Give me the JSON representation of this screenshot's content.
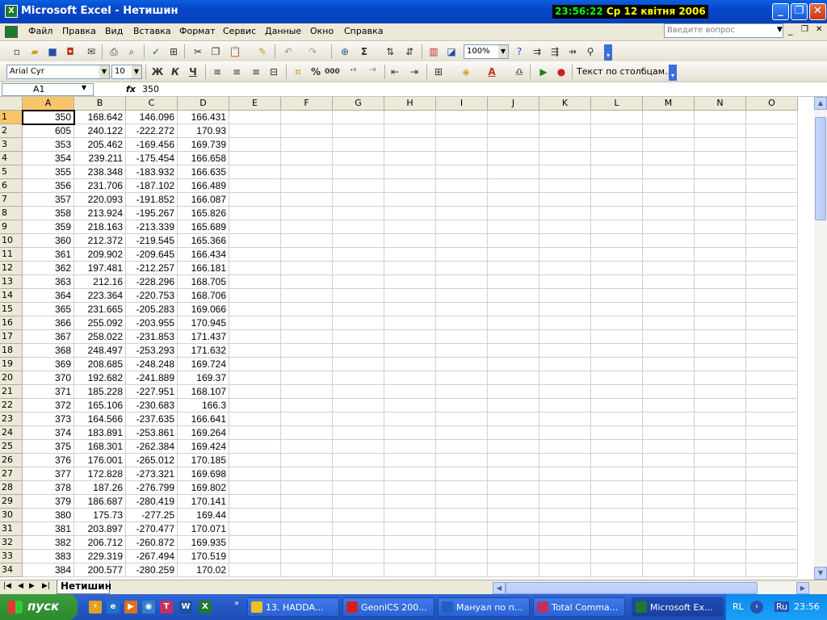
{
  "window": {
    "title": "Microsoft Excel - Нетишин",
    "min": "_",
    "max": "❐",
    "close": "✕"
  },
  "clock": {
    "time": "23:56:22",
    "date": "Ср 12 квітня 2006"
  },
  "menu": [
    "Файл",
    "Правка",
    "Вид",
    "Вставка",
    "Формат",
    "Сервис",
    "Данные",
    "Окно",
    "Справка"
  ],
  "help": {
    "placeholder": "Введите вопрос"
  },
  "toolbar": {
    "zoom": "100%",
    "font": "Arial Cyr",
    "size": "10",
    "bold": "Ж",
    "italic": "К",
    "underline": "Ч",
    "text_to_columns": "Текст по столбцам...",
    "percent": "%",
    "thousands": "000"
  },
  "formula": {
    "cell_ref": "A1",
    "fx": "fx",
    "value": "350"
  },
  "columns": [
    "A",
    "B",
    "C",
    "D",
    "E",
    "F",
    "G",
    "H",
    "I",
    "J",
    "K",
    "L",
    "M",
    "N",
    "O"
  ],
  "rows": [
    [
      "350",
      "168.642",
      "146.096",
      "166.431"
    ],
    [
      "605",
      "240.122",
      "-222.272",
      "170.93"
    ],
    [
      "353",
      "205.462",
      "-169.456",
      "169.739"
    ],
    [
      "354",
      "239.211",
      "-175.454",
      "166.658"
    ],
    [
      "355",
      "238.348",
      "-183.932",
      "166.635"
    ],
    [
      "356",
      "231.706",
      "-187.102",
      "166.489"
    ],
    [
      "357",
      "220.093",
      "-191.852",
      "166.087"
    ],
    [
      "358",
      "213.924",
      "-195.267",
      "165.826"
    ],
    [
      "359",
      "218.163",
      "-213.339",
      "165.689"
    ],
    [
      "360",
      "212.372",
      "-219.545",
      "165.366"
    ],
    [
      "361",
      "209.902",
      "-209.645",
      "166.434"
    ],
    [
      "362",
      "197.481",
      "-212.257",
      "166.181"
    ],
    [
      "363",
      "212.16",
      "-228.296",
      "168.705"
    ],
    [
      "364",
      "223.364",
      "-220.753",
      "168.706"
    ],
    [
      "365",
      "231.665",
      "-205.283",
      "169.066"
    ],
    [
      "366",
      "255.092",
      "-203.955",
      "170.945"
    ],
    [
      "367",
      "258.022",
      "-231.853",
      "171.437"
    ],
    [
      "368",
      "248.497",
      "-253.293",
      "171.632"
    ],
    [
      "369",
      "208.685",
      "-248.248",
      "169.724"
    ],
    [
      "370",
      "192.682",
      "-241.889",
      "169.37"
    ],
    [
      "371",
      "185.228",
      "-227.951",
      "168.107"
    ],
    [
      "372",
      "165.106",
      "-230.683",
      "166.3"
    ],
    [
      "373",
      "164.566",
      "-237.635",
      "166.641"
    ],
    [
      "374",
      "183.891",
      "-253.861",
      "169.264"
    ],
    [
      "375",
      "168.301",
      "-262.384",
      "169.424"
    ],
    [
      "376",
      "176.001",
      "-265.012",
      "170.185"
    ],
    [
      "377",
      "172.828",
      "-273.321",
      "169.698"
    ],
    [
      "378",
      "187.26",
      "-276.799",
      "169.802"
    ],
    [
      "379",
      "186.687",
      "-280.419",
      "170.141"
    ],
    [
      "380",
      "175.73",
      "-277.25",
      "169.44"
    ],
    [
      "381",
      "203.897",
      "-270.477",
      "170.071"
    ],
    [
      "382",
      "206.712",
      "-260.872",
      "169.935"
    ],
    [
      "383",
      "229.319",
      "-267.494",
      "170.519"
    ],
    [
      "384",
      "200.577",
      "-280.259",
      "170.02"
    ]
  ],
  "sheet": {
    "tab": "Нетишин"
  },
  "taskbar": {
    "start": "пуск",
    "tasks": [
      {
        "label": "13. HADDA...",
        "color": "#f0c020"
      },
      {
        "label": "GeoniCS 200...",
        "color": "#d02020"
      },
      {
        "label": "Мануал по п...",
        "color": "#2060c0"
      },
      {
        "label": "Total Comma...",
        "color": "#c03060"
      },
      {
        "label": "Microsoft Ex...",
        "color": "#1e7a2e"
      }
    ],
    "lang": "RL",
    "ru": "Ru",
    "time": "23:56"
  }
}
